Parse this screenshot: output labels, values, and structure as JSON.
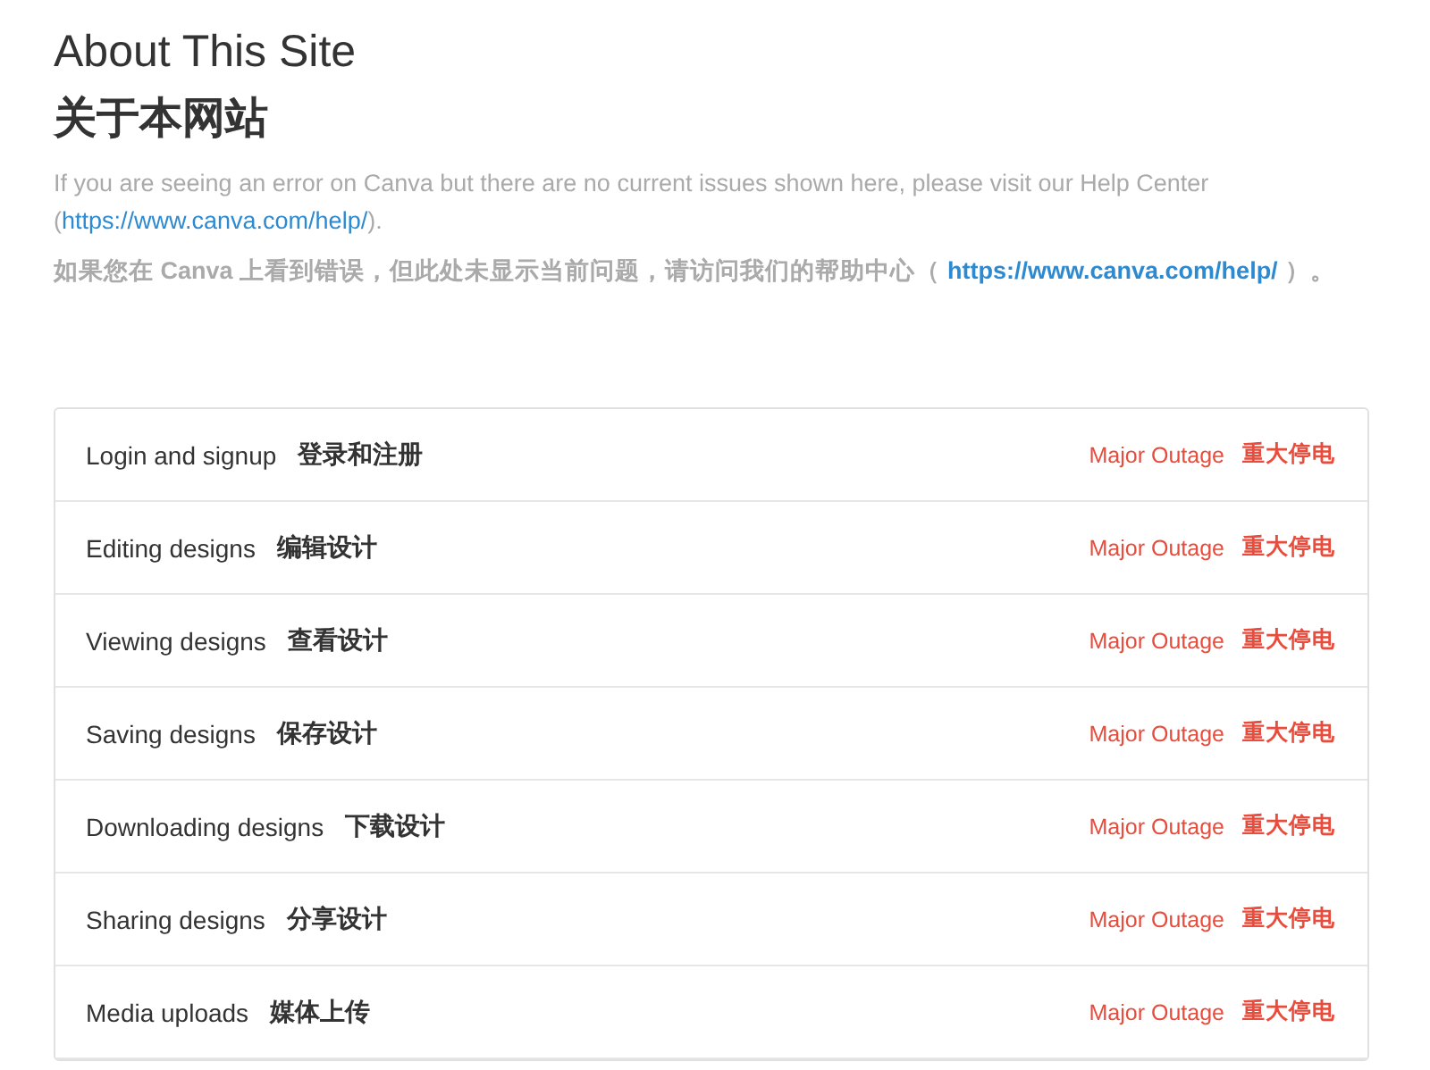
{
  "title": "About This Site",
  "title_zh": "关于本网站",
  "notice": {
    "before": "If you are seeing an error on Canva but there are no current issues shown here, please visit our Help Center (",
    "link": "https://www.canva.com/help/",
    "after": ")."
  },
  "notice_zh": {
    "before": "如果您在 Canva 上看到错误，但此处未显示当前问题，请访问我们的帮助中心（",
    "link": "https://www.canva.com/help/",
    "after": "）。"
  },
  "components": [
    {
      "name": "Login and signup",
      "name_zh": "登录和注册",
      "status": {
        "kind": "major_outage",
        "label": "Major Outage",
        "label_zh": "重大停电"
      }
    },
    {
      "name": "Editing designs",
      "name_zh": "编辑设计",
      "status": {
        "kind": "major_outage",
        "label": "Major Outage",
        "label_zh": "重大停电"
      }
    },
    {
      "name": "Viewing designs",
      "name_zh": "查看设计",
      "status": {
        "kind": "major_outage",
        "label": "Major Outage",
        "label_zh": "重大停电"
      }
    },
    {
      "name": "Saving designs",
      "name_zh": "保存设计",
      "status": {
        "kind": "major_outage",
        "label": "Major Outage",
        "label_zh": "重大停电"
      }
    },
    {
      "name": "Downloading designs",
      "name_zh": "下载设计",
      "status": {
        "kind": "major_outage",
        "label": "Major Outage",
        "label_zh": "重大停电"
      }
    },
    {
      "name": "Sharing designs",
      "name_zh": "分享设计",
      "status": {
        "kind": "major_outage",
        "label": "Major Outage",
        "label_zh": "重大停电"
      }
    },
    {
      "name": "Media uploads",
      "name_zh": "媒体上传",
      "status": {
        "kind": "major_outage",
        "label": "Major Outage",
        "label_zh": "重大停电"
      }
    }
  ]
}
